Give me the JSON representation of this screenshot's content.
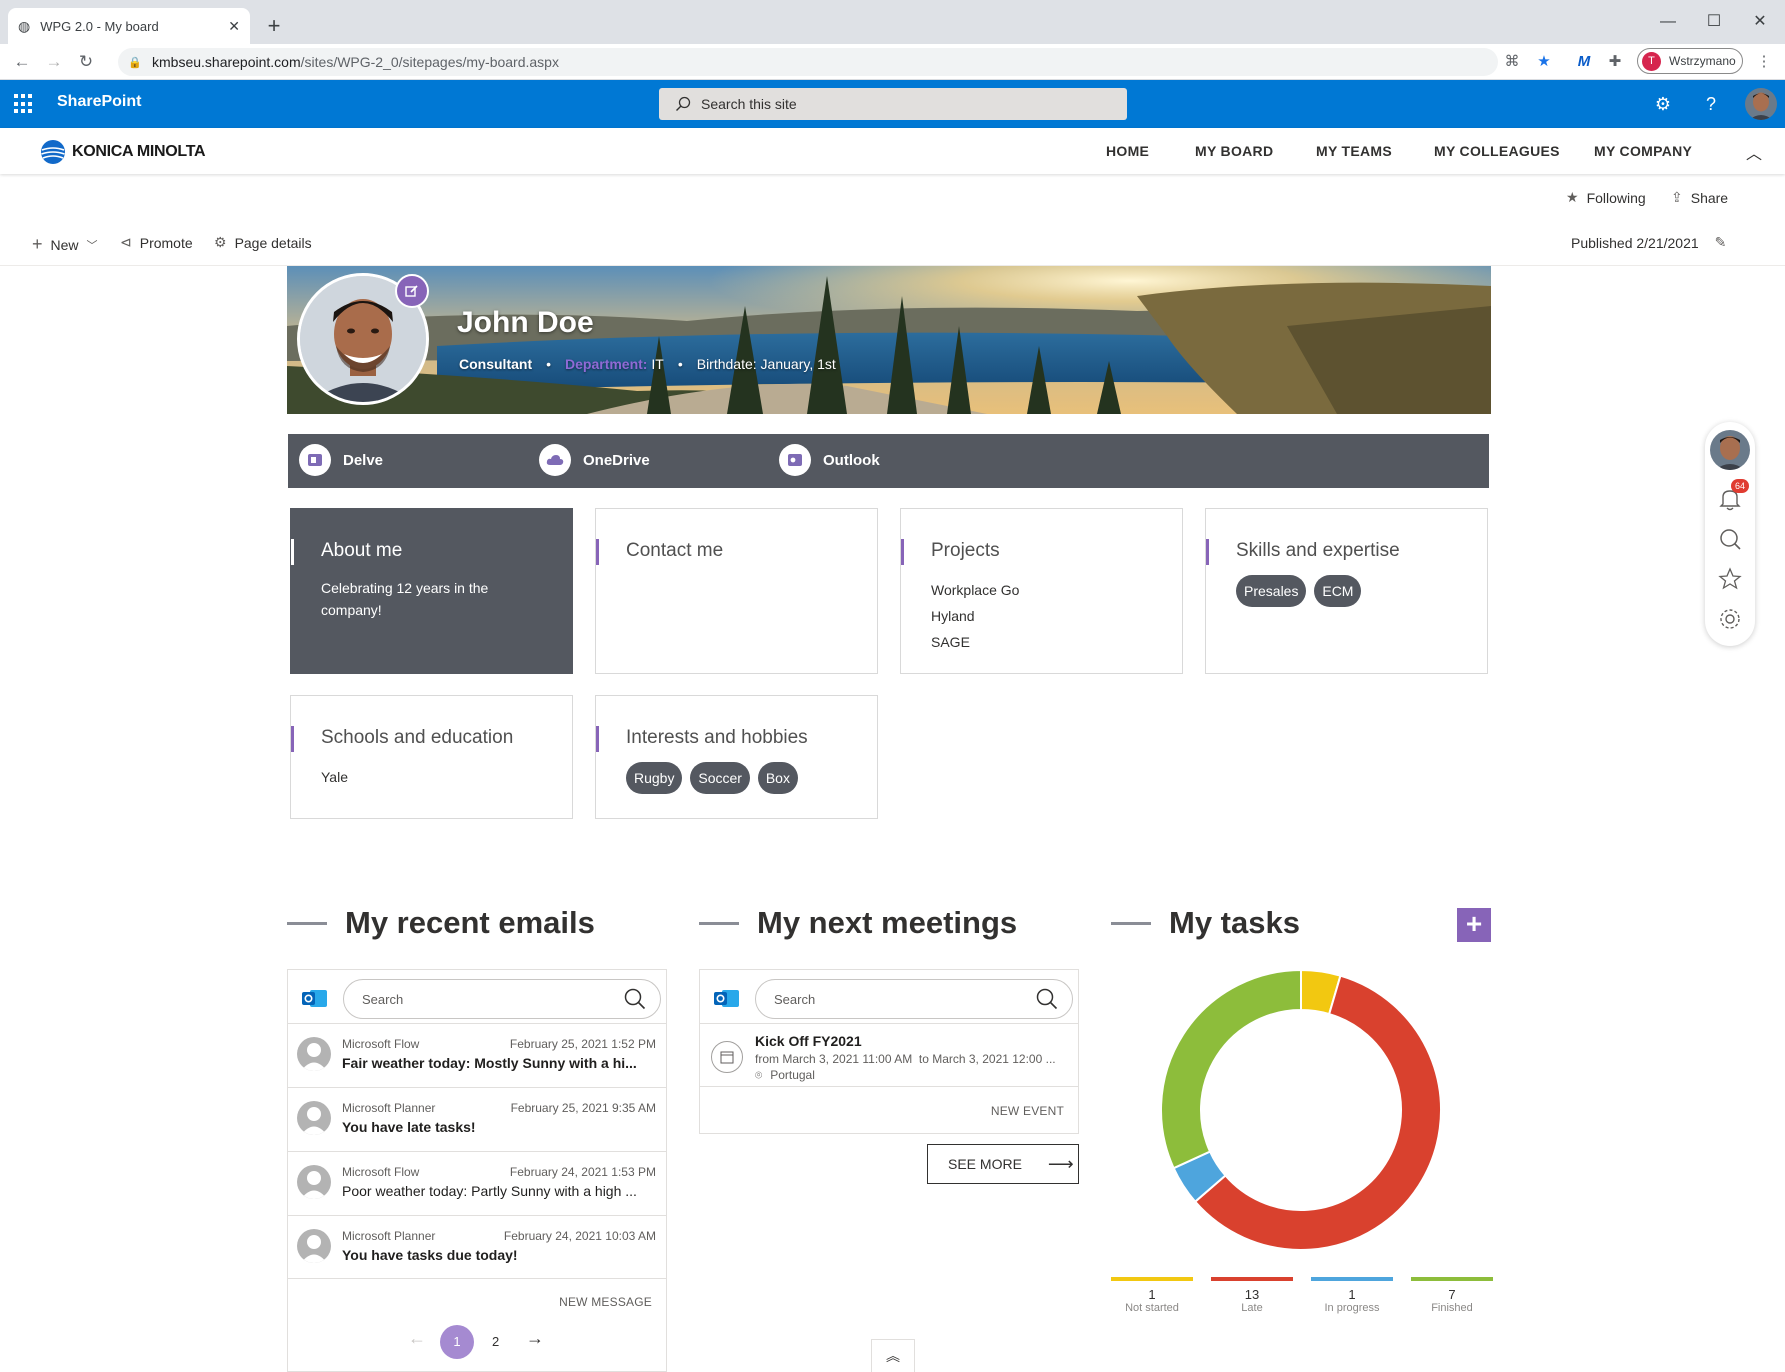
{
  "browser": {
    "tab_title": "WPG 2.0 - My board",
    "url_host": "kmbseu.sharepoint.com",
    "url_path": "/sites/WPG-2_0/sitepages/my-board.aspx",
    "profile_initial": "T",
    "profile_label": "Wstrzymano"
  },
  "suite": {
    "app_name": "SharePoint",
    "search_placeholder": "Search this site"
  },
  "site": {
    "logo_text": "KONICA MINOLTA",
    "nav": [
      "HOME",
      "MY BOARD",
      "MY TEAMS",
      "MY COLLEAGUES",
      "MY COMPANY"
    ],
    "following": "Following",
    "share": "Share"
  },
  "commandbar": {
    "new": "New",
    "promote": "Promote",
    "page_details": "Page details",
    "published": "Published 2/21/2021"
  },
  "profile": {
    "name": "John Doe",
    "title": "Consultant",
    "department_label": "Department:",
    "department": "IT",
    "birthdate": "Birthdate: January, 1st"
  },
  "apps": [
    "Delve",
    "OneDrive",
    "Outlook"
  ],
  "cards": {
    "about": {
      "title": "About me",
      "text": "Celebrating 12 years in the company!"
    },
    "contact": {
      "title": "Contact me"
    },
    "projects": {
      "title": "Projects",
      "items": [
        "Workplace Go",
        "Hyland",
        "SAGE"
      ]
    },
    "skills": {
      "title": "Skills and expertise",
      "tags": [
        "Presales",
        "ECM"
      ]
    },
    "schools": {
      "title": "Schools and education",
      "items": [
        "Yale"
      ]
    },
    "interests": {
      "title": "Interests and hobbies",
      "tags": [
        "Rugby",
        "Soccer",
        "Box"
      ]
    }
  },
  "emails": {
    "heading": "My recent emails",
    "search_placeholder": "Search",
    "items": [
      {
        "from": "Microsoft Flow",
        "date": "February 25, 2021 1:52 PM",
        "subject": "Fair weather today: Mostly Sunny with a hi...",
        "unread": true
      },
      {
        "from": "Microsoft Planner",
        "date": "February 25, 2021 9:35 AM",
        "subject": "You have late tasks!",
        "unread": true
      },
      {
        "from": "Microsoft Flow",
        "date": "February 24, 2021 1:53 PM",
        "subject": "Poor weather today: Partly Sunny with a high ...",
        "unread": false
      },
      {
        "from": "Microsoft Planner",
        "date": "February 24, 2021 10:03 AM",
        "subject": "You have tasks due today!",
        "unread": true
      }
    ],
    "new_message": "NEW MESSAGE",
    "pages": [
      "1",
      "2"
    ],
    "current_page": "1"
  },
  "meetings": {
    "heading": "My next meetings",
    "search_placeholder": "Search",
    "items": [
      {
        "title": "Kick Off FY2021",
        "when": "from March 3, 2021 11:00 AM  to March 3, 2021 12:00 ...",
        "location": "Portugal"
      }
    ],
    "new_event": "NEW EVENT",
    "see_more": "SEE MORE"
  },
  "tasks": {
    "heading": "My tasks",
    "add_label": "+"
  },
  "chart_data": {
    "type": "pie",
    "title": "",
    "categories": [
      "Not started",
      "Late",
      "In progress",
      "Finished"
    ],
    "values": [
      1,
      13,
      1,
      7
    ],
    "colors": [
      "#f2c811",
      "#d9412e",
      "#4ea5dd",
      "#8dbd3b"
    ]
  },
  "notifications_badge": "64",
  "colors": {
    "accent": "#8764b8",
    "suite_blue": "#0078d4",
    "panel_gray": "#545860"
  }
}
